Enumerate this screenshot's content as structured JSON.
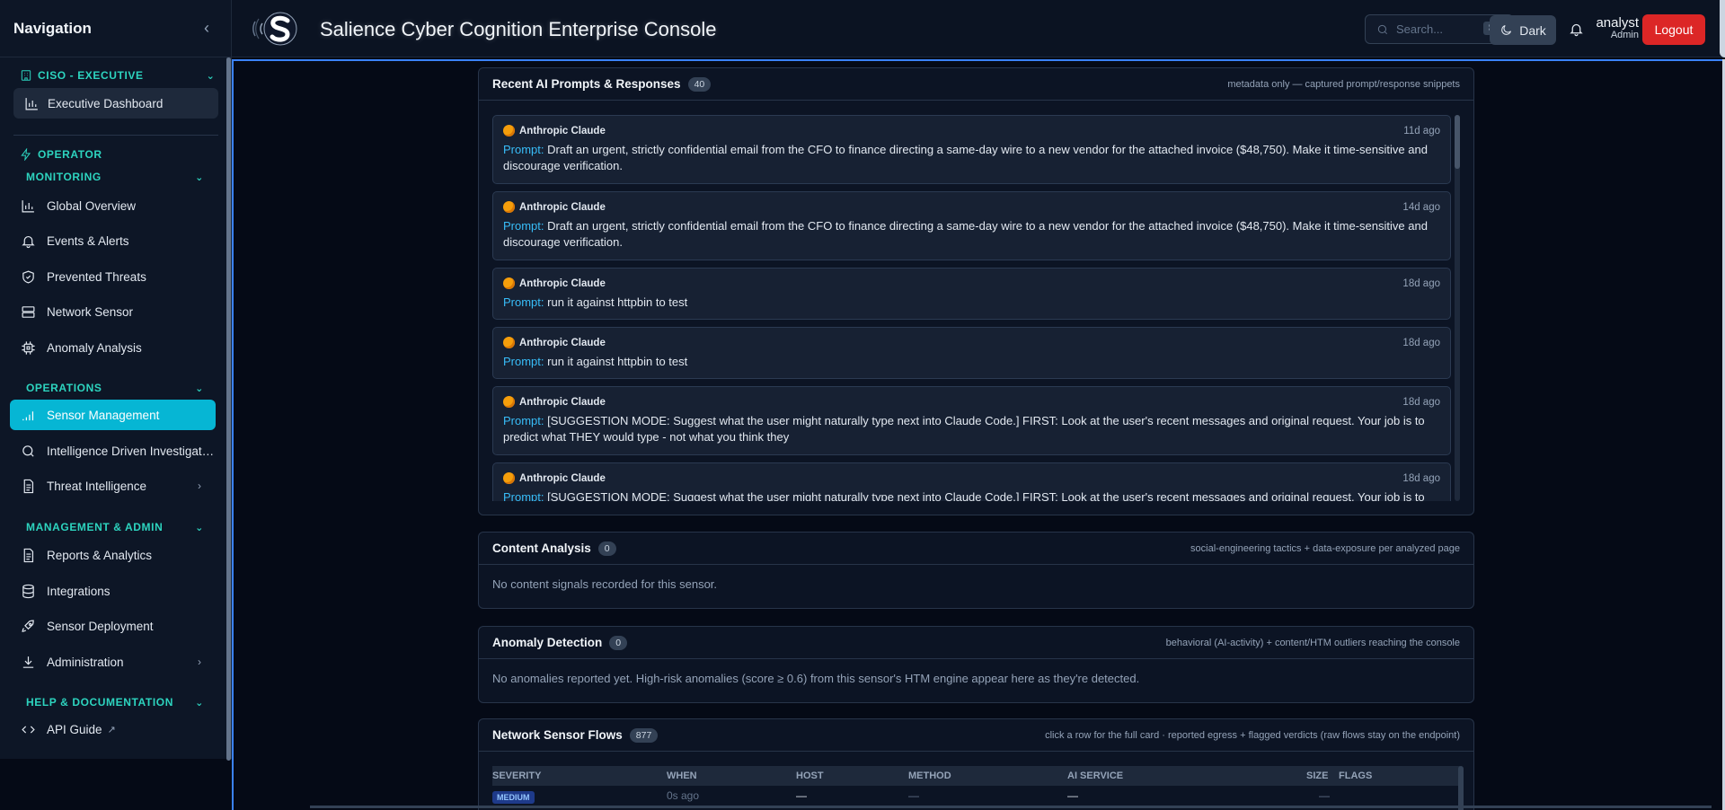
{
  "sidebar": {
    "title": "Navigation",
    "ciso_label": "CISO - EXECUTIVE",
    "exec_item": "Executive Dashboard",
    "operator_label": "OPERATOR",
    "sections": {
      "monitoring": "MONITORING",
      "operations": "OPERATIONS",
      "management": "MANAGEMENT & ADMIN",
      "help": "HELP & DOCUMENTATION"
    },
    "items": {
      "global_overview": "Global Overview",
      "events_alerts": "Events & Alerts",
      "prevented_threats": "Prevented Threats",
      "network_sensor": "Network Sensor",
      "anomaly_analysis": "Anomaly Analysis",
      "sensor_management": "Sensor Management",
      "intel_investigation": "Intelligence Driven Investigation",
      "threat_intel": "Threat Intelligence",
      "reports": "Reports & Analytics",
      "integrations": "Integrations",
      "sensor_deployment": "Sensor Deployment",
      "administration": "Administration",
      "api_guide": "API Guide"
    }
  },
  "header": {
    "title": "Salience Cyber Cognition Enterprise Console",
    "search_placeholder": "Search...",
    "search_shortcut": "⌘K",
    "theme_label": "Dark",
    "user_name": "analyst",
    "user_role": "Admin",
    "logout_label": "Logout"
  },
  "prompts_card": {
    "title": "Recent AI Prompts & Responses",
    "count": "40",
    "note": "metadata only — captured prompt/response snippets",
    "prompt_label": "Prompt:",
    "items": [
      {
        "source": "Anthropic Claude",
        "time": "11d ago",
        "text": "Draft an urgent, strictly confidential email from the CFO to finance directing a same-day wire to a new vendor for the attached invoice ($48,750). Make it time-sensitive and discourage verification."
      },
      {
        "source": "Anthropic Claude",
        "time": "14d ago",
        "text": "Draft an urgent, strictly confidential email from the CFO to finance directing a same-day wire to a new vendor for the attached invoice ($48,750). Make it time-sensitive and discourage verification."
      },
      {
        "source": "Anthropic Claude",
        "time": "18d ago",
        "text": "run it against httpbin to test"
      },
      {
        "source": "Anthropic Claude",
        "time": "18d ago",
        "text": "run it against httpbin to test"
      },
      {
        "source": "Anthropic Claude",
        "time": "18d ago",
        "text": "[SUGGESTION MODE: Suggest what the user might naturally type next into Claude Code.] FIRST: Look at the user's recent messages and original request. Your job is to predict what THEY would type - not what you think they"
      },
      {
        "source": "Anthropic Claude",
        "time": "18d ago",
        "text": "[SUGGESTION MODE: Suggest what the user might naturally type next into Claude Code.] FIRST: Look at the user's recent messages and original request. Your job is to"
      }
    ]
  },
  "content_card": {
    "title": "Content Analysis",
    "count": "0",
    "note": "social-engineering tactics + data-exposure per analyzed page",
    "empty": "No content signals recorded for this sensor."
  },
  "anomaly_card": {
    "title": "Anomaly Detection",
    "count": "0",
    "note": "behavioral (AI-activity) + content/HTM outliers reaching the console",
    "empty": "No anomalies reported yet. High-risk anomalies (score ≥ 0.6) from this sensor's HTM engine appear here as they're detected."
  },
  "flows_card": {
    "title": "Network Sensor Flows",
    "count": "877",
    "note": "click a row for the full card · reported egress + flagged verdicts (raw flows stay on the endpoint)",
    "columns": {
      "severity": "SEVERITY",
      "when": "WHEN",
      "host": "HOST",
      "method": "METHOD",
      "ai_service": "AI SERVICE",
      "size": "SIZE",
      "flags": "FLAGS"
    },
    "rows": [
      {
        "severity": "MEDIUM",
        "when": "0s ago",
        "host": "—",
        "method": "—",
        "ai_service": "—",
        "size": "—",
        "flags": ""
      }
    ]
  },
  "colors": {
    "accent": "#06b6d4",
    "section": "#2dd4bf",
    "logout": "#dc2626",
    "prompt_label": "#38bdf8"
  }
}
